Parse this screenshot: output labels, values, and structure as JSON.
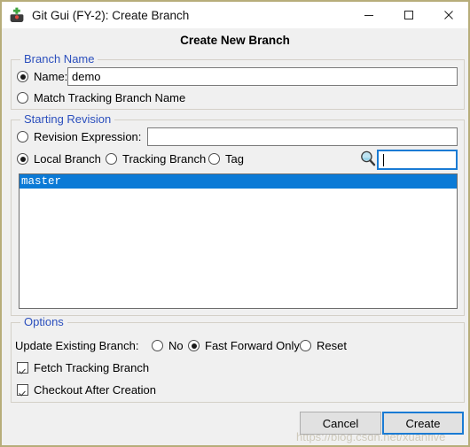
{
  "window": {
    "title": "Git Gui (FY-2): Create Branch",
    "icon": "git-gui-icon",
    "border_color": "#b7ad7a",
    "controls": {
      "minimize": "minimize-icon",
      "maximize": "maximize-icon",
      "close": "close-icon"
    }
  },
  "dialog": {
    "header": "Create New Branch"
  },
  "branch_name": {
    "group_title": "Branch Name",
    "name_radio_label": "Name:",
    "name_radio_selected": true,
    "name_value": "demo",
    "match_tracking_label": "Match Tracking Branch Name",
    "match_tracking_selected": false
  },
  "starting_revision": {
    "group_title": "Starting Revision",
    "revision_expression_label": "Revision Expression:",
    "revision_expression_selected": false,
    "revision_expression_value": "",
    "local_branch_label": "Local Branch",
    "local_branch_selected": true,
    "tracking_branch_label": "Tracking Branch",
    "tracking_branch_selected": false,
    "tag_label": "Tag",
    "tag_selected": false,
    "filter_icon": "magnifier-icon",
    "filter_value": "",
    "branches": [
      {
        "name": "master",
        "selected": true
      }
    ]
  },
  "options": {
    "group_title": "Options",
    "update_existing_label": "Update Existing Branch:",
    "update_existing_choices": [
      {
        "label": "No",
        "selected": false
      },
      {
        "label": "Fast Forward Only",
        "selected": true
      },
      {
        "label": "Reset",
        "selected": false
      }
    ],
    "fetch_tracking_label": "Fetch Tracking Branch",
    "fetch_tracking_checked": true,
    "checkout_after_label": "Checkout After Creation",
    "checkout_after_checked": true
  },
  "footer": {
    "cancel_label": "Cancel",
    "create_label": "Create",
    "create_is_default": true
  },
  "watermark": {
    "text": "https://blog.csdn.net/xuanfive"
  },
  "colors": {
    "accent_blue": "#0b7ad6",
    "focus_blue": "#1a7bd4",
    "group_title_blue": "#2b4fbd",
    "window_bg": "#f0f0f0",
    "frame": "#b7ad7a"
  }
}
